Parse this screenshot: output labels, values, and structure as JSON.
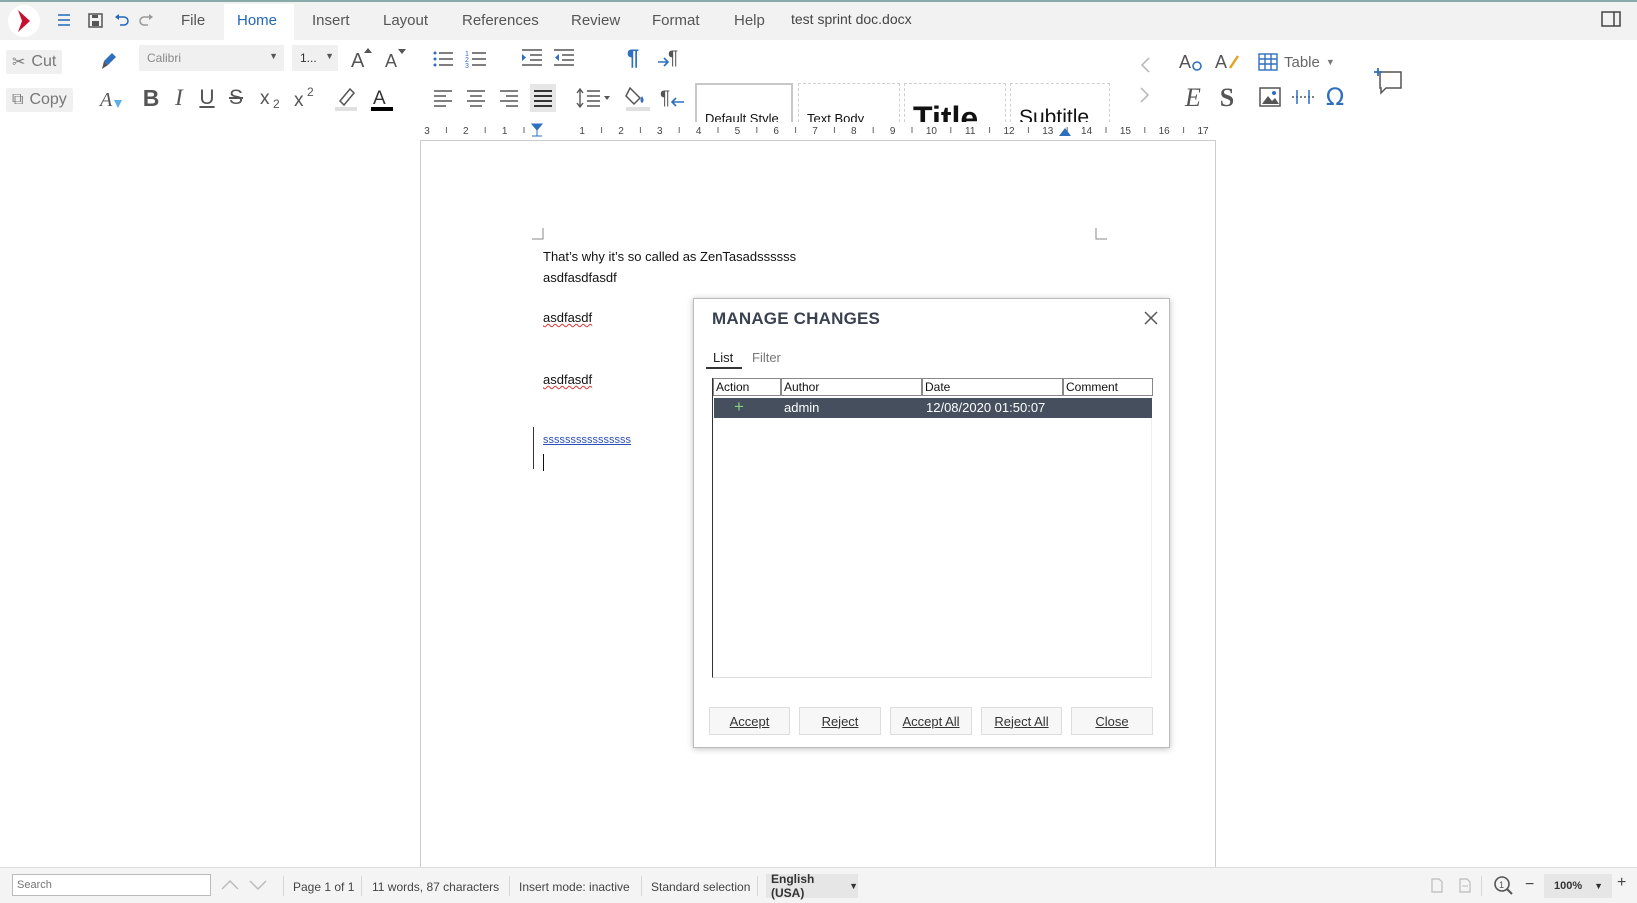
{
  "app": {
    "document_title": "test sprint doc.docx"
  },
  "menu": {
    "tabs": [
      "File",
      "Home",
      "Insert",
      "Layout",
      "References",
      "Review",
      "Format",
      "Help"
    ],
    "active": "Home"
  },
  "toolbar": {
    "cut_label": "Cut",
    "copy_label": "Copy",
    "font_name": "Calibri",
    "font_size": "1...",
    "styles": [
      "Default Style",
      "Text Body",
      "Title",
      "Subtitle"
    ],
    "table_label": "Table"
  },
  "ruler": {
    "ticks": [
      "3",
      "2",
      "1",
      "1",
      "2",
      "3",
      "4",
      "5",
      "6",
      "7",
      "8",
      "9",
      "10",
      "11",
      "12",
      "13",
      "14",
      "15",
      "16",
      "17"
    ]
  },
  "document": {
    "lines": [
      "That’s why it’s so called as ZenTasadssssss",
      "asdfasdfasdf",
      "asdfasdf",
      "asdfasdf",
      "ssssssssssssssss"
    ]
  },
  "dialog": {
    "title": "MANAGE CHANGES",
    "tabs": [
      "List",
      "Filter"
    ],
    "active_tab": "List",
    "columns": [
      "Action",
      "Author",
      "Date",
      "Comment"
    ],
    "rows": [
      {
        "action": "+",
        "author": "admin",
        "date": "12/08/2020 01:50:07",
        "comment": ""
      }
    ],
    "buttons": [
      "Accept",
      "Reject",
      "Accept All",
      "Reject All",
      "Close"
    ]
  },
  "status": {
    "search_placeholder": "Search",
    "page": "Page 1 of 1",
    "counts": "11 words, 87 characters",
    "insert_mode": "Insert mode: inactive",
    "selection": "Standard selection",
    "language": "English (USA)",
    "zoom": "100%"
  },
  "colors": {
    "accent": "#2367b8",
    "selected_row": "#454f5e",
    "logo": "#c8102e"
  }
}
